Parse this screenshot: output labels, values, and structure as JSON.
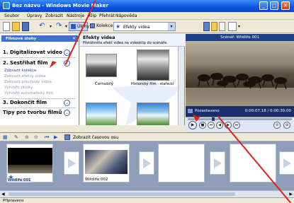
{
  "window": {
    "title": "Bez názvu - Windows Movie Maker"
  },
  "menu": [
    "Soubor",
    "Úpravy",
    "Zobrazit",
    "Nástroje",
    "Klip",
    "Přehrát",
    "Nápověda"
  ],
  "toolbar": {
    "tasks_label": "Úlohy",
    "collections_label": "Kolekce",
    "effects_dropdown": "Efekty videa"
  },
  "tasks_pane": {
    "header": "Filmové úlohy",
    "sections": [
      {
        "number": "1.",
        "title": "Digitalizovat video",
        "chevron": "⌄"
      },
      {
        "number": "2.",
        "title": "Sestřihat film",
        "chevron": "⌃"
      },
      {
        "number": "3.",
        "title": "Dokončit film",
        "chevron": "⌄"
      }
    ],
    "links": [
      "Zobrazit kolekce",
      "Zobrazit efekty videa",
      "Zobrazit přechody videa",
      "Vytvořit titulky",
      "Vytvořit automatický film"
    ],
    "tips": "Tipy pro tvorbu filmů"
  },
  "effects_pane": {
    "title": "Efekty videa",
    "subtitle": "Přetáhněte efekt videa na videoklip do scénáře.",
    "items": [
      {
        "label": "Černobílý"
      },
      {
        "label": "Historický film - stařeckí"
      }
    ]
  },
  "monitor": {
    "title": "Scénář: Wildlife 001",
    "status": "Pozastaveno",
    "time": "0:00:07,18 / 0:00:30,00"
  },
  "storyboard": {
    "toggle_label": "Zobrazit časovou osu",
    "clips": [
      "Wildlife 001",
      "Wildlife 002"
    ]
  },
  "status_bar": "Připraveno"
}
